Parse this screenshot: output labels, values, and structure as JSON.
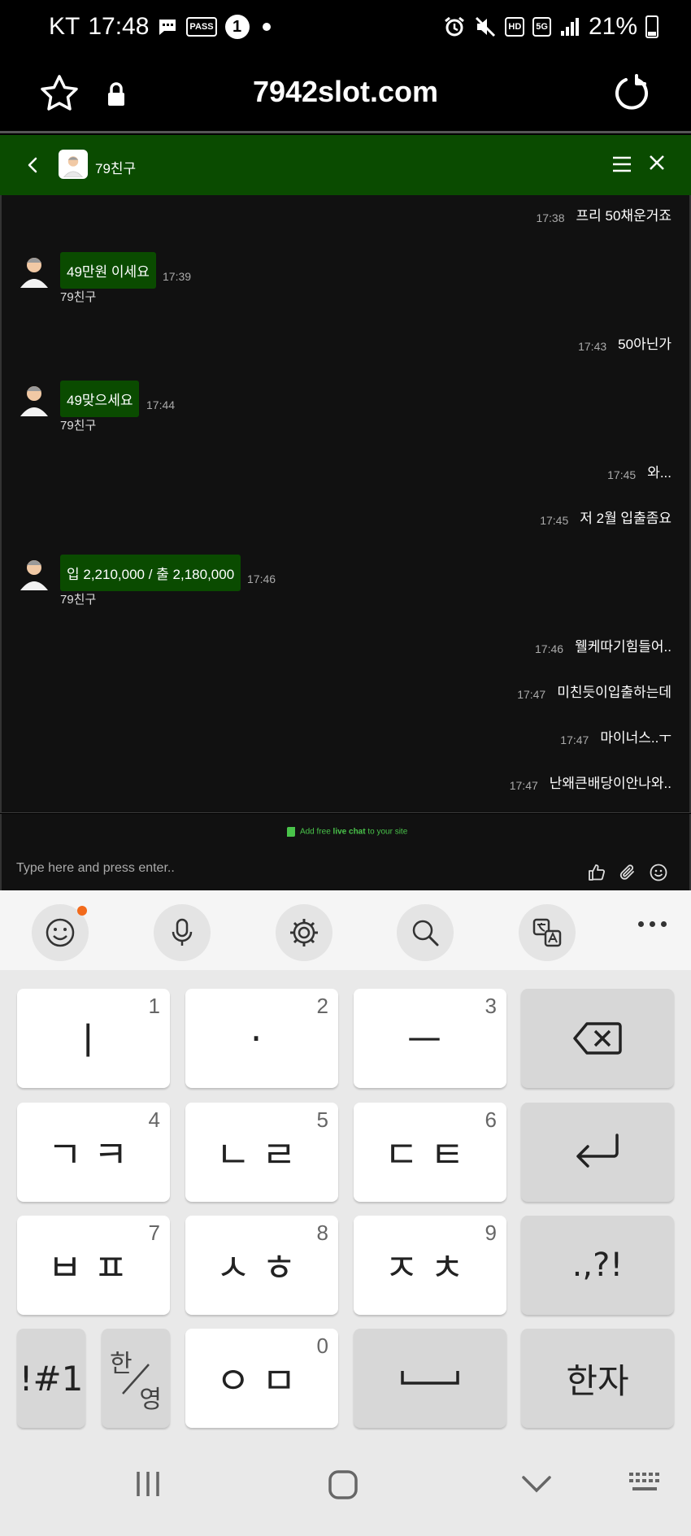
{
  "status": {
    "carrier": "KT",
    "time": "17:48",
    "pass_label": "PASS",
    "notif_count": "1",
    "hd_label": "HD",
    "net_label": "5G",
    "battery": "21%"
  },
  "browser": {
    "url": "7942slot.com"
  },
  "chat": {
    "title": "79친구",
    "messages": [
      {
        "side": "right",
        "time": "17:38",
        "text": "프리 50채운거죠"
      },
      {
        "side": "left",
        "time": "17:39",
        "text": "49만원 이세요",
        "sender": "79친구"
      },
      {
        "side": "right",
        "time": "17:43",
        "text": "50아닌가"
      },
      {
        "side": "left",
        "time": "17:44",
        "text": "49맞으세요",
        "sender": "79친구"
      },
      {
        "side": "right",
        "time": "17:45",
        "text": "와..."
      },
      {
        "side": "right",
        "time": "17:45",
        "text": "저 2월 입출좀요"
      },
      {
        "side": "left",
        "time": "17:46",
        "text": "입 2,210,000 / 출 2,180,000",
        "sender": "79친구"
      },
      {
        "side": "right",
        "time": "17:46",
        "text": "웰케따기힘들어.."
      },
      {
        "side": "right",
        "time": "17:47",
        "text": "미친듯이입출하는데"
      },
      {
        "side": "right",
        "time": "17:47",
        "text": "마이너스..ㅜ"
      },
      {
        "side": "right",
        "time": "17:47",
        "text": "난왜큰배당이안나와.."
      }
    ],
    "promo_prefix": "Add free",
    "promo_link": "live chat",
    "promo_suffix": "to your site",
    "input_placeholder": "Type here and press enter.."
  },
  "keyboard": {
    "keys": [
      {
        "main": "ㅣ",
        "num": "1"
      },
      {
        "main": "·",
        "num": "2"
      },
      {
        "main": "ㅡ",
        "num": "3"
      },
      {
        "main": "ㄱㅋ",
        "num": "4"
      },
      {
        "main": "ㄴㄹ",
        "num": "5"
      },
      {
        "main": "ㄷㅌ",
        "num": "6"
      },
      {
        "main": "ㅂㅍ",
        "num": "7"
      },
      {
        "main": "ㅅㅎ",
        "num": "8"
      },
      {
        "main": "ㅈㅊ",
        "num": "9"
      },
      {
        "main": "ㅇㅁ",
        "num": "0"
      }
    ],
    "punct": ".,?!",
    "symbols": "!#1",
    "lang_top": "한",
    "lang_bottom": "영",
    "hanja": "한자"
  }
}
